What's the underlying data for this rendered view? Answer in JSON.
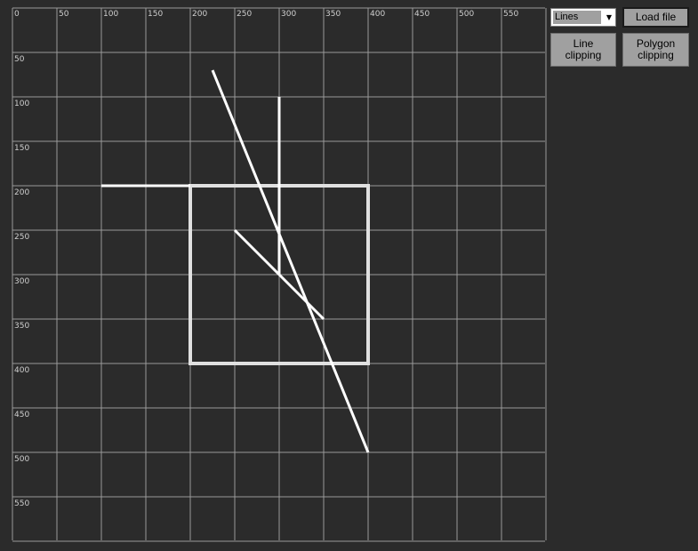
{
  "controls": {
    "mode_select": {
      "selected": "Lines"
    },
    "load_button": "Load file",
    "line_clipping_button": "Line\nclipping",
    "polygon_clipping_button": "Polygon\nclipping"
  },
  "plot": {
    "x_ticks": [
      "0",
      "50",
      "100",
      "150",
      "200",
      "250",
      "300",
      "350",
      "400",
      "450",
      "500",
      "550"
    ],
    "y_ticks": [
      "50",
      "100",
      "150",
      "200",
      "250",
      "300",
      "350",
      "400",
      "450",
      "500",
      "550"
    ],
    "x_max": 600,
    "y_max": 600,
    "grid": true,
    "colors": {
      "background": "#2b2b2b",
      "grid": "#9a9a9a",
      "lines": "#ffffff",
      "clip_window": "#e0e0e0"
    },
    "clip_window": {
      "x1": 200,
      "y1": 200,
      "x2": 400,
      "y2": 400
    },
    "segments": [
      {
        "x1": 100,
        "y1": 200,
        "x2": 200,
        "y2": 200
      },
      {
        "x1": 300,
        "y1": 100,
        "x2": 300,
        "y2": 300
      },
      {
        "x1": 225,
        "y1": 70,
        "x2": 400,
        "y2": 500
      },
      {
        "x1": 250,
        "y1": 250,
        "x2": 350,
        "y2": 350
      }
    ]
  }
}
